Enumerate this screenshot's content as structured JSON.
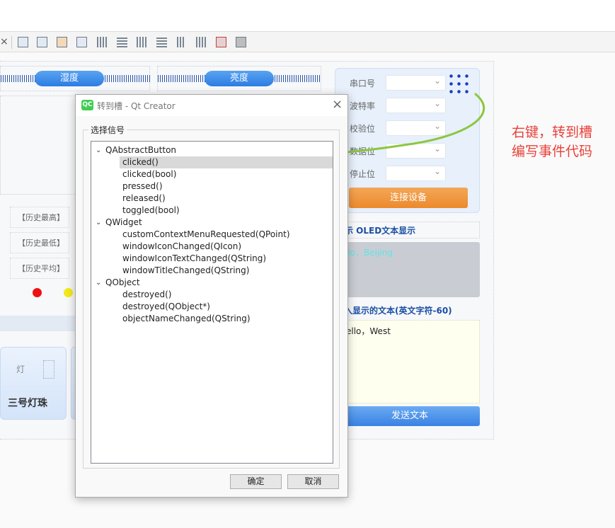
{
  "toolbar": {
    "close_glyph": "×",
    "icons": [
      "edit-widgets-icon",
      "edit-signals-slots-icon",
      "edit-buddies-icon",
      "edit-tab-order-icon",
      "layout-horizontal-icon",
      "layout-vertical-icon",
      "layout-horizontal-splitter-icon",
      "layout-vertical-splitter-icon",
      "layout-form-icon",
      "layout-grid-icon",
      "break-layout-icon",
      "adjust-size-icon"
    ]
  },
  "form": {
    "humidity_label": "湿度",
    "brightness_label": "亮度",
    "history": [
      "【历史最高】",
      "【历史最低】",
      "【历史平均】"
    ],
    "lamp_char": "灯",
    "lamp_card_title": "三号灯珠",
    "indicator_colors": [
      "#ee1111",
      "#f3ea17"
    ],
    "serial": {
      "labels": [
        "串口号",
        "波特率",
        "校验位",
        "数据位",
        "停止位"
      ],
      "connect_label": "连接设备"
    },
    "oled_header": "示   OLED文本显示",
    "oled_text": "llo，Beijing",
    "input_header": "入显示的文本(英文字符-60)",
    "input_text": "ello，West",
    "send_label": "发送文本"
  },
  "annotation": {
    "line1": "右键，转到槽",
    "line2": "编写事件代码",
    "color": "#e8413a",
    "arrow_color": "#8cc63f"
  },
  "dialog": {
    "logo_text": "QC",
    "title": "转到槽 - Qt Creator",
    "group_title": "选择信号",
    "tree": [
      {
        "label": "QAbstractButton",
        "level": 0,
        "expanded": true
      },
      {
        "label": "clicked()",
        "level": 1,
        "selected": true
      },
      {
        "label": "clicked(bool)",
        "level": 1
      },
      {
        "label": "pressed()",
        "level": 1
      },
      {
        "label": "released()",
        "level": 1
      },
      {
        "label": "toggled(bool)",
        "level": 1
      },
      {
        "label": "QWidget",
        "level": 0,
        "expanded": true
      },
      {
        "label": "customContextMenuRequested(QPoint)",
        "level": 1
      },
      {
        "label": "windowIconChanged(QIcon)",
        "level": 1
      },
      {
        "label": "windowIconTextChanged(QString)",
        "level": 1
      },
      {
        "label": "windowTitleChanged(QString)",
        "level": 1
      },
      {
        "label": "QObject",
        "level": 0,
        "expanded": true
      },
      {
        "label": "destroyed()",
        "level": 1
      },
      {
        "label": "destroyed(QObject*)",
        "level": 1
      },
      {
        "label": "objectNameChanged(QString)",
        "level": 1
      }
    ],
    "ok_label": "确定",
    "cancel_label": "取消"
  }
}
